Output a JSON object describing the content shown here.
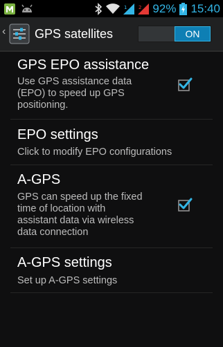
{
  "status_bar": {
    "left_icons": [
      "m-notification-icon",
      "android-debug-icon"
    ],
    "right_icons": [
      "bluetooth-icon",
      "wifi-icon",
      "signal-1-icon",
      "signal-2-icon",
      "battery-charging-icon"
    ],
    "battery_percent": "92%",
    "time": "15:40",
    "accent_color": "#33b5e5"
  },
  "action_bar": {
    "up_indicator": "‹",
    "icon": "gps-settings-icon",
    "title": "GPS satellites",
    "switch": {
      "state": "ON",
      "on": true
    }
  },
  "preferences": [
    {
      "title": "GPS EPO assistance",
      "summary_lines": [
        "Use GPS assistance data",
        "(EPO) to speed up GPS",
        "positioning."
      ],
      "checked": true
    },
    {
      "title": "EPO settings",
      "summary_lines": [
        "Click to modify EPO configurations"
      ]
    },
    {
      "title": "A-GPS",
      "summary_lines": [
        "GPS can speed up the fixed",
        "time of location with",
        "assistant data via wireless",
        "data connection"
      ],
      "checked": true
    },
    {
      "title": "A-GPS settings",
      "summary_lines": [
        "Set up A-GPS settings"
      ]
    }
  ]
}
